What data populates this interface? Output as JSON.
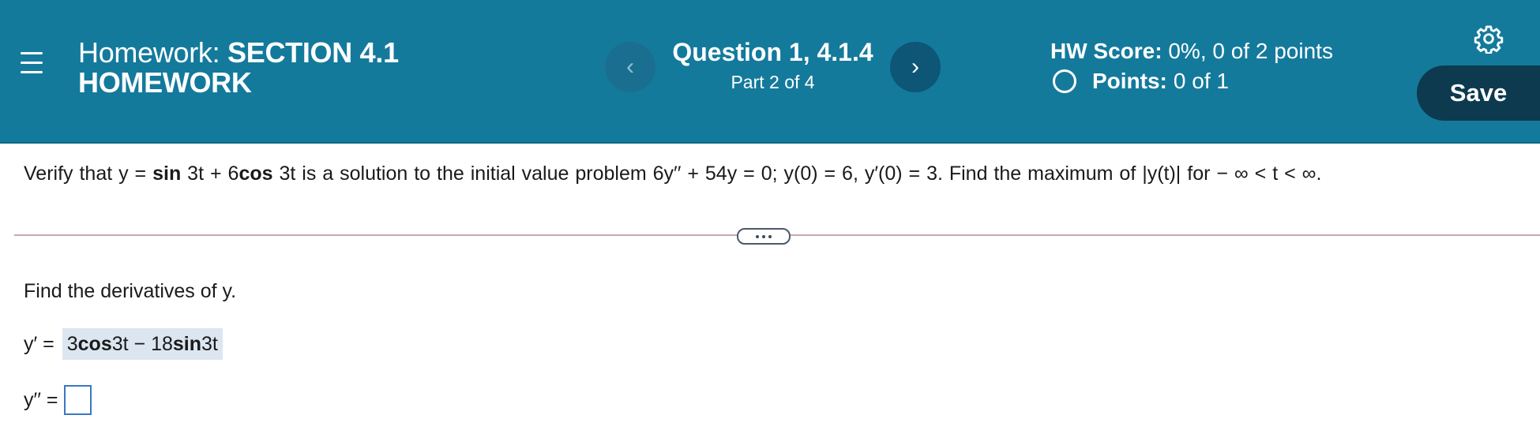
{
  "header": {
    "homework_prefix": "Homework:",
    "homework_title_1": "SECTION 4.1",
    "homework_title_2": "HOMEWORK",
    "question_title": "Question 1, 4.1.4",
    "question_part": "Part 2 of 4",
    "hw_score_label": "HW Score:",
    "hw_score_value": "0%, 0 of 2 points",
    "points_label": "Points:",
    "points_value": "0 of 1",
    "save_label": "Save",
    "prev_icon": "‹",
    "next_icon": "›"
  },
  "problem": {
    "p1": "Verify that y = ",
    "sin": "sin",
    "p2": " 3t + 6",
    "cos": "cos",
    "p3": " 3t is a solution to the initial value problem 6y′′ + 54y = 0; y(0) = 6, y′(0) = 3. Find the maximum of |y(t)| for  − ∞ < t < ∞."
  },
  "work": {
    "prompt": "Find the derivatives of y.",
    "y1_label": "y′ =",
    "y1_a": "3 ",
    "y1_cos": "cos",
    "y1_b": " 3t − 18 ",
    "y1_sin": "sin",
    "y1_c": " 3t",
    "y2_label": "y′′ ="
  },
  "colors": {
    "header_bg": "#147a9c",
    "save_bg": "#0d3a4f",
    "answer_bg": "#dce6f1",
    "input_border": "#3a78c2"
  }
}
